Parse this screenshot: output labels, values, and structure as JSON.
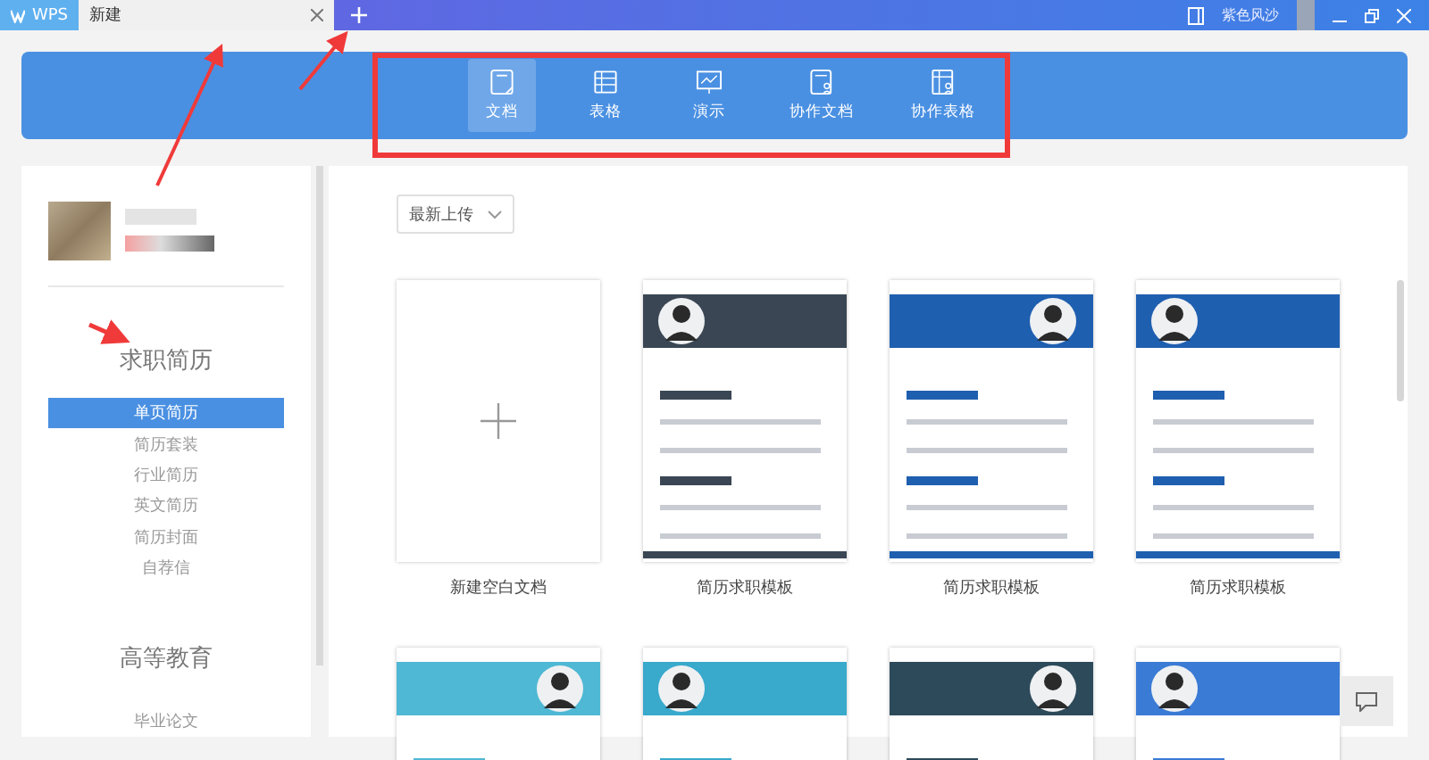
{
  "tabs": [
    {
      "label": "WPS",
      "kind": "app",
      "selected": false
    },
    {
      "label": "新建",
      "kind": "doc",
      "selected": true
    }
  ],
  "title_bar": {
    "skin": "紫色风沙"
  },
  "doc_types": [
    {
      "label": "文档",
      "kind": "doc",
      "selected": true
    },
    {
      "label": "表格",
      "kind": "sheet",
      "selected": false
    },
    {
      "label": "演示",
      "kind": "slides",
      "selected": false
    },
    {
      "label": "协作文档",
      "kind": "cowork-doc",
      "selected": false
    },
    {
      "label": "协作表格",
      "kind": "cowork-sheet",
      "selected": false
    }
  ],
  "sidebar": {
    "sections": [
      {
        "title": "求职简历",
        "items": [
          {
            "label": "单页简历",
            "selected": true
          },
          {
            "label": "简历套装",
            "selected": false
          },
          {
            "label": "行业简历",
            "selected": false
          },
          {
            "label": "英文简历",
            "selected": false
          },
          {
            "label": "简历封面",
            "selected": false
          },
          {
            "label": "自荐信",
            "selected": false
          }
        ]
      },
      {
        "title": "高等教育",
        "items": [
          {
            "label": "毕业论文",
            "selected": false
          }
        ]
      }
    ]
  },
  "sort": {
    "value": "最新上传"
  },
  "templates": [
    {
      "kind": "blank",
      "label": "新建空白文档"
    },
    {
      "kind": "picture",
      "label": "简历求职模板"
    },
    {
      "kind": "picture",
      "label": "简历求职模板"
    },
    {
      "kind": "picture",
      "label": "简历求职模板"
    },
    {
      "kind": "picture"
    },
    {
      "kind": "picture"
    },
    {
      "kind": "picture"
    },
    {
      "kind": "picture"
    }
  ]
}
